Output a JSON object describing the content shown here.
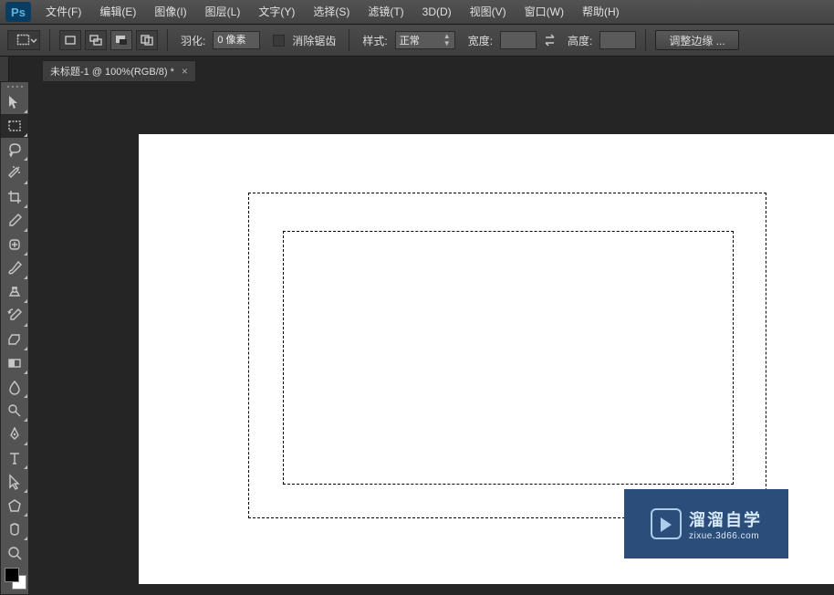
{
  "app": {
    "logo_text": "Ps"
  },
  "menu": {
    "file": "文件(F)",
    "edit": "编辑(E)",
    "image": "图像(I)",
    "layer": "图层(L)",
    "type": "文字(Y)",
    "select": "选择(S)",
    "filter": "滤镜(T)",
    "threeD": "3D(D)",
    "view": "视图(V)",
    "window": "窗口(W)",
    "help": "帮助(H)"
  },
  "options": {
    "feather_label": "羽化:",
    "feather_value": "0 像素",
    "antialias_label": "消除锯齿",
    "style_label": "样式:",
    "style_value": "正常",
    "width_label": "宽度:",
    "height_label": "高度:",
    "refine_edge": "调整边缘 ..."
  },
  "document": {
    "tab_title": "未标题-1 @ 100%(RGB/8) *",
    "tab_close": "×"
  },
  "watermark": {
    "line1": "溜溜自学",
    "line2": "zixue.3d66.com"
  },
  "tools": [
    "move",
    "rect-marquee",
    "lasso",
    "magic-wand",
    "crop",
    "eyedropper",
    "healing-brush",
    "brush",
    "clone-stamp",
    "history-brush",
    "eraser",
    "gradient",
    "blur",
    "dodge",
    "pen",
    "type",
    "path-select",
    "rectangle",
    "hand",
    "zoom"
  ]
}
